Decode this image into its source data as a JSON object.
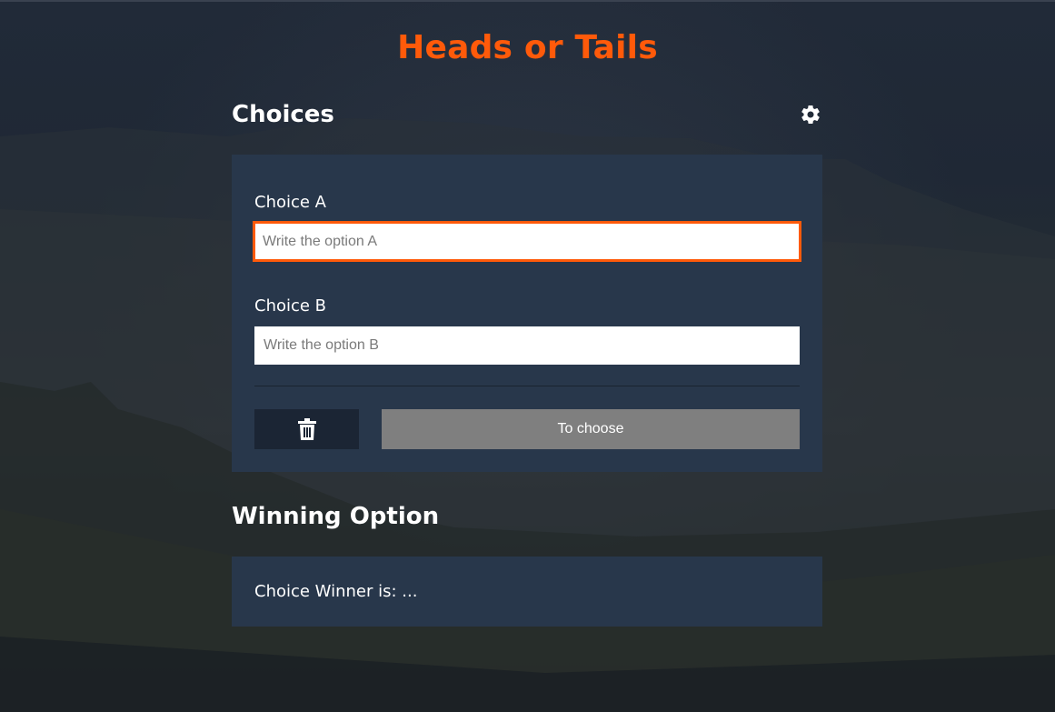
{
  "app": {
    "title": "Heads or Tails"
  },
  "choices": {
    "heading": "Choices",
    "settings_icon": "gear-icon",
    "choice_a": {
      "label": "Choice A",
      "placeholder": "Write the option A",
      "value": ""
    },
    "choice_b": {
      "label": "Choice B",
      "placeholder": "Write the option B",
      "value": ""
    },
    "delete_icon": "trash-icon",
    "choose_label": "To choose"
  },
  "winning": {
    "heading": "Winning Option",
    "result_text": "Choice Winner is: ..."
  },
  "colors": {
    "accent": "#ff5a0a",
    "card": "#28374b",
    "button_disabled": "#7f7f7f",
    "delete_button": "#1b2534"
  }
}
